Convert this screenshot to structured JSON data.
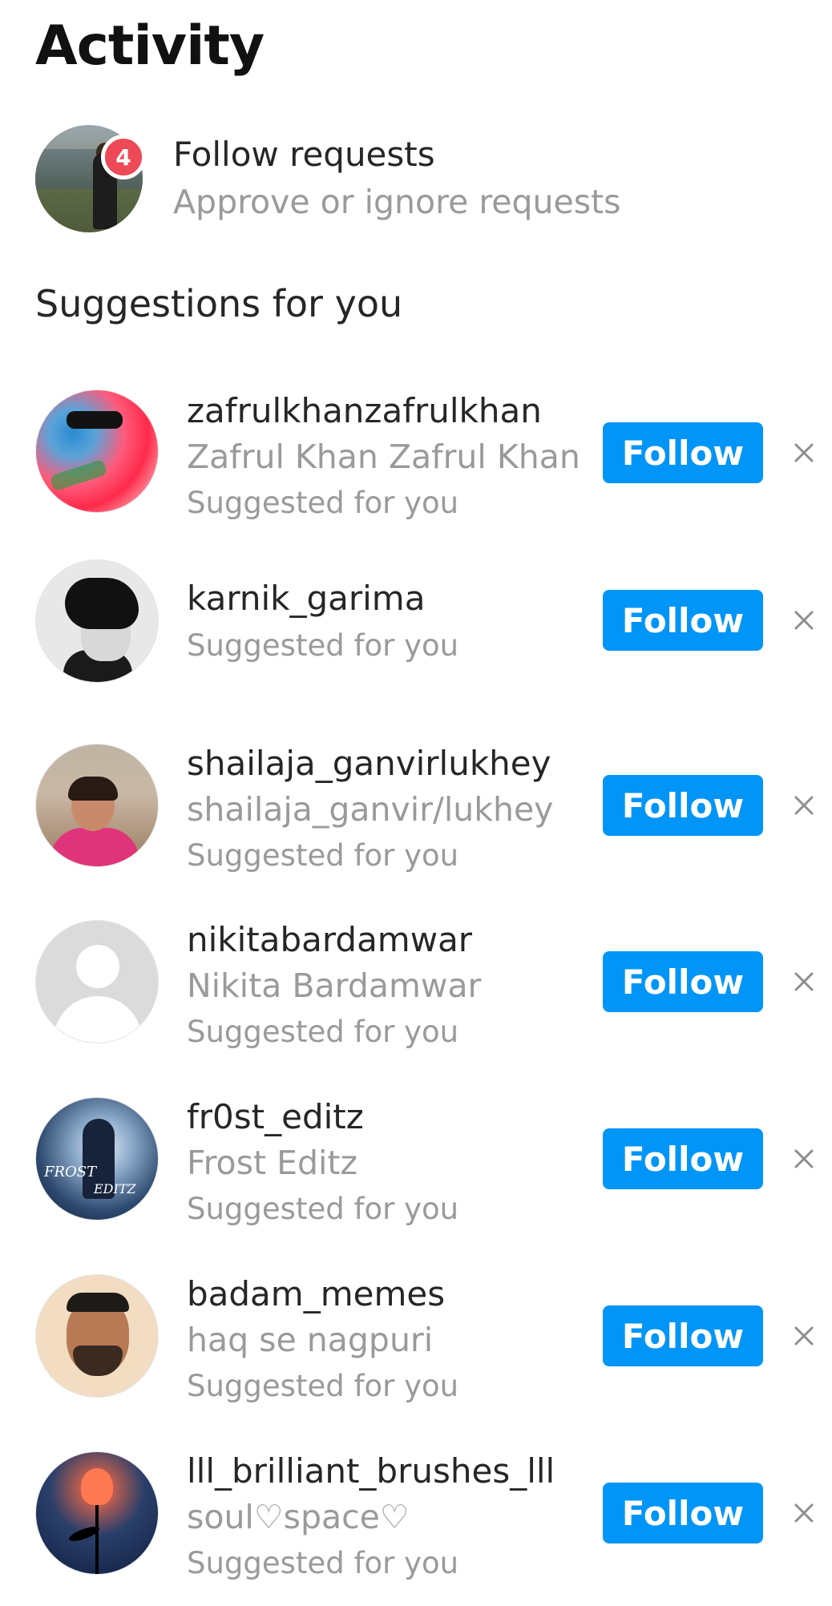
{
  "header": {
    "title": "Activity"
  },
  "follow_requests": {
    "badge_count": "4",
    "title": "Follow requests",
    "subtitle": "Approve or ignore requests"
  },
  "suggestions": {
    "section_title": "Suggestions for you",
    "follow_label": "Follow",
    "items": [
      {
        "username": "zafrulkhanzafrulkhan",
        "full_name": "Zafrul Khan Zafrul Khan",
        "meta": "Suggested for you"
      },
      {
        "username": "karnik_garima",
        "full_name": "",
        "meta": "Suggested for you"
      },
      {
        "username": "shailaja_ganvirlukhey",
        "full_name": "shailaja_ganvir/lukhey",
        "meta": "Suggested for you"
      },
      {
        "username": "nikitabardamwar",
        "full_name": "Nikita Bardamwar",
        "meta": "Suggested for you"
      },
      {
        "username": "fr0st_editz",
        "full_name": "Frost Editz",
        "meta": "Suggested for you",
        "avatar_text_1": "FROST",
        "avatar_text_2": "EDITZ"
      },
      {
        "username": "badam_memes",
        "full_name": "haq se nagpuri",
        "meta": "Suggested for you"
      },
      {
        "username": "lll_brilliant_brushes_lll",
        "full_name": "soul♡space♡",
        "meta": "Suggested for you"
      }
    ]
  },
  "colors": {
    "follow_button": "#0095f6",
    "badge": "#ed4956",
    "secondary_text": "#9a9a9a"
  }
}
